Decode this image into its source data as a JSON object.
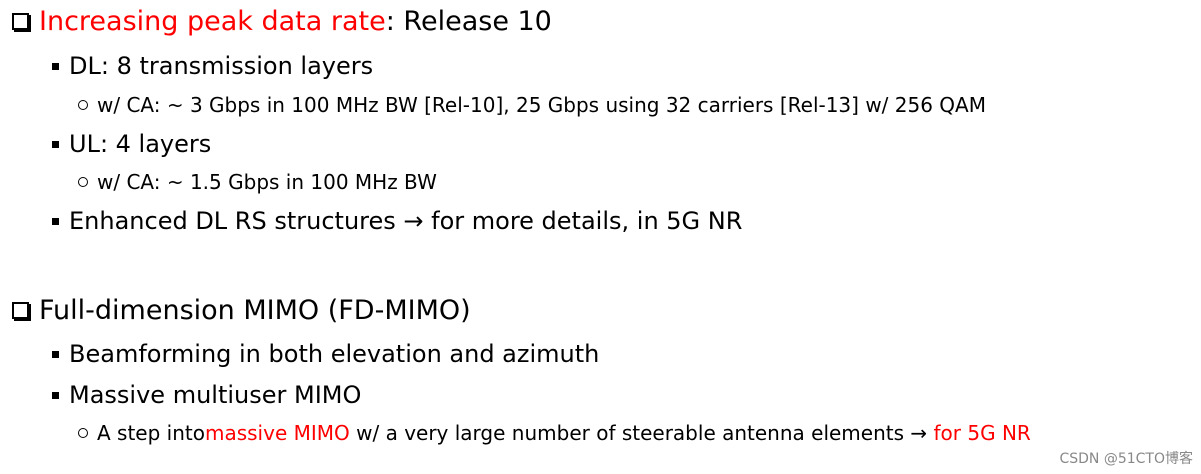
{
  "section1": {
    "heading_highlight": "Increasing peak data rate",
    "heading_rest": ": Release 10",
    "items": [
      {
        "text": "DL: 8 transmission layers"
      },
      {
        "text": "w/ CA: ~ 3 Gbps in 100 MHz BW [Rel-10], 25 Gbps using 32 carriers [Rel-13] w/ 256 QAM"
      },
      {
        "text": "UL: 4 layers"
      },
      {
        "text": "w/ CA: ~ 1.5 Gbps in 100 MHz BW"
      },
      {
        "text": "Enhanced DL RS structures → for more details, in 5G NR"
      }
    ]
  },
  "section2": {
    "heading": "Full-dimension MIMO (FD-MIMO)",
    "items": [
      {
        "text": "Beamforming in both elevation and azimuth"
      },
      {
        "text": "Massive multiuser MIMO"
      }
    ],
    "sub": {
      "part1": "A step into ",
      "part2_red": "massive MIMO",
      "part3": " w/ a very large number of steerable antenna elements → ",
      "part4_red": "for 5G NR"
    }
  },
  "watermark": "CSDN @51CTO博客",
  "colors": {
    "highlight": "#ff0000",
    "text": "#000000"
  },
  "icons": {
    "level1": "hollow-square-bullet",
    "level2": "filled-square-bullet",
    "level3": "hollow-circle-bullet"
  }
}
